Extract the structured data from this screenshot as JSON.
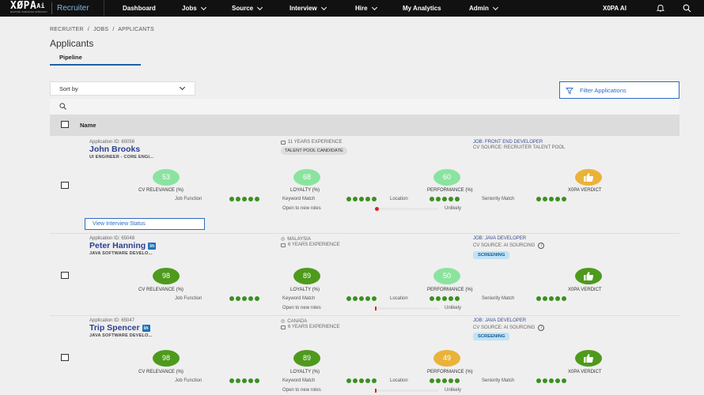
{
  "nav": {
    "logo_main": "XØPA",
    "logo_ai": "Ai",
    "logo_sub": "MACHINE HUMANLIKE APPROACH",
    "app_name": "Recruiter",
    "items": [
      {
        "label": "Dashboard",
        "has_menu": false
      },
      {
        "label": "Jobs",
        "has_menu": true
      },
      {
        "label": "Source",
        "has_menu": true
      },
      {
        "label": "Interview",
        "has_menu": true
      },
      {
        "label": "Hire",
        "has_menu": true
      },
      {
        "label": "My Analytics",
        "has_menu": false
      },
      {
        "label": "Admin",
        "has_menu": true
      }
    ],
    "user": "X0PA AI"
  },
  "breadcrumb": [
    "RECRUITER",
    "/",
    "JOBS",
    "/",
    "APPLICANTS"
  ],
  "page_title": "Applicants",
  "tab_label": "Pipeline",
  "sort_label": "Sort by",
  "filter_label": "Filter Applications",
  "table_header": "Name",
  "labels": {
    "cv": "CV RELEVANCE (%)",
    "loyalty": "LOYALTY (%)",
    "performance": "PERFORMANCE (%)",
    "verdict": "X0PA VERDICT",
    "job_function": "Job Function",
    "keyword": "Keyword Match",
    "location": "Location",
    "seniority": "Seniority Match",
    "open_roles": "Open to new roles",
    "unlikely": "Unlikely",
    "view_status": "View Interview Status"
  },
  "applicants": [
    {
      "app_id": "Application ID: 65056",
      "name": "John Brooks",
      "linkedin": false,
      "role": "UI ENGINEER - CORE ENGI...",
      "meta1": "11 YEARS EXPERIENCE",
      "meta2": "",
      "tag": "TALENT POOL CANDIDATE",
      "job": "JOB: FRONT END DEVELOPER",
      "source": "CV SOURCE: RECRUITER TALENT POOL",
      "status_tag": "",
      "cv": "53",
      "loyalty": "68",
      "performance": "60",
      "verdict_color": "#eab23a"
    },
    {
      "app_id": "Application ID: 65048",
      "name": "Peter Hanning",
      "linkedin": true,
      "role": "JAVA SOFTWARE DEVELO...",
      "meta1": "MALAYSIA",
      "meta2": "6 YEARS EXPERIENCE",
      "tag": "",
      "job": "JOB: JAVA DEVELOPER",
      "source": "CV SOURCE: AI SOURCING",
      "status_tag": "SCREENING",
      "cv": "98",
      "loyalty": "89",
      "performance": "50",
      "verdict_color": "#4e9a1c"
    },
    {
      "app_id": "Application ID: 65047",
      "name": "Trip Spencer",
      "linkedin": true,
      "role": "JAVA SOFTWARE DEVELO...",
      "meta1": "CANADA",
      "meta2": "6 YEARS EXPERIENCE",
      "tag": "",
      "job": "JOB: JAVA DEVELOPER",
      "source": "CV SOURCE: AI SOURCING",
      "status_tag": "SCREENING",
      "cv": "98",
      "loyalty": "89",
      "performance": "49",
      "verdict_color": "#4e9a1c"
    }
  ],
  "colors": {
    "accent": "#2e6bc0",
    "name": "#2b3f8f",
    "dot_green": "#3c8f22",
    "nav_bg": "#111111"
  }
}
